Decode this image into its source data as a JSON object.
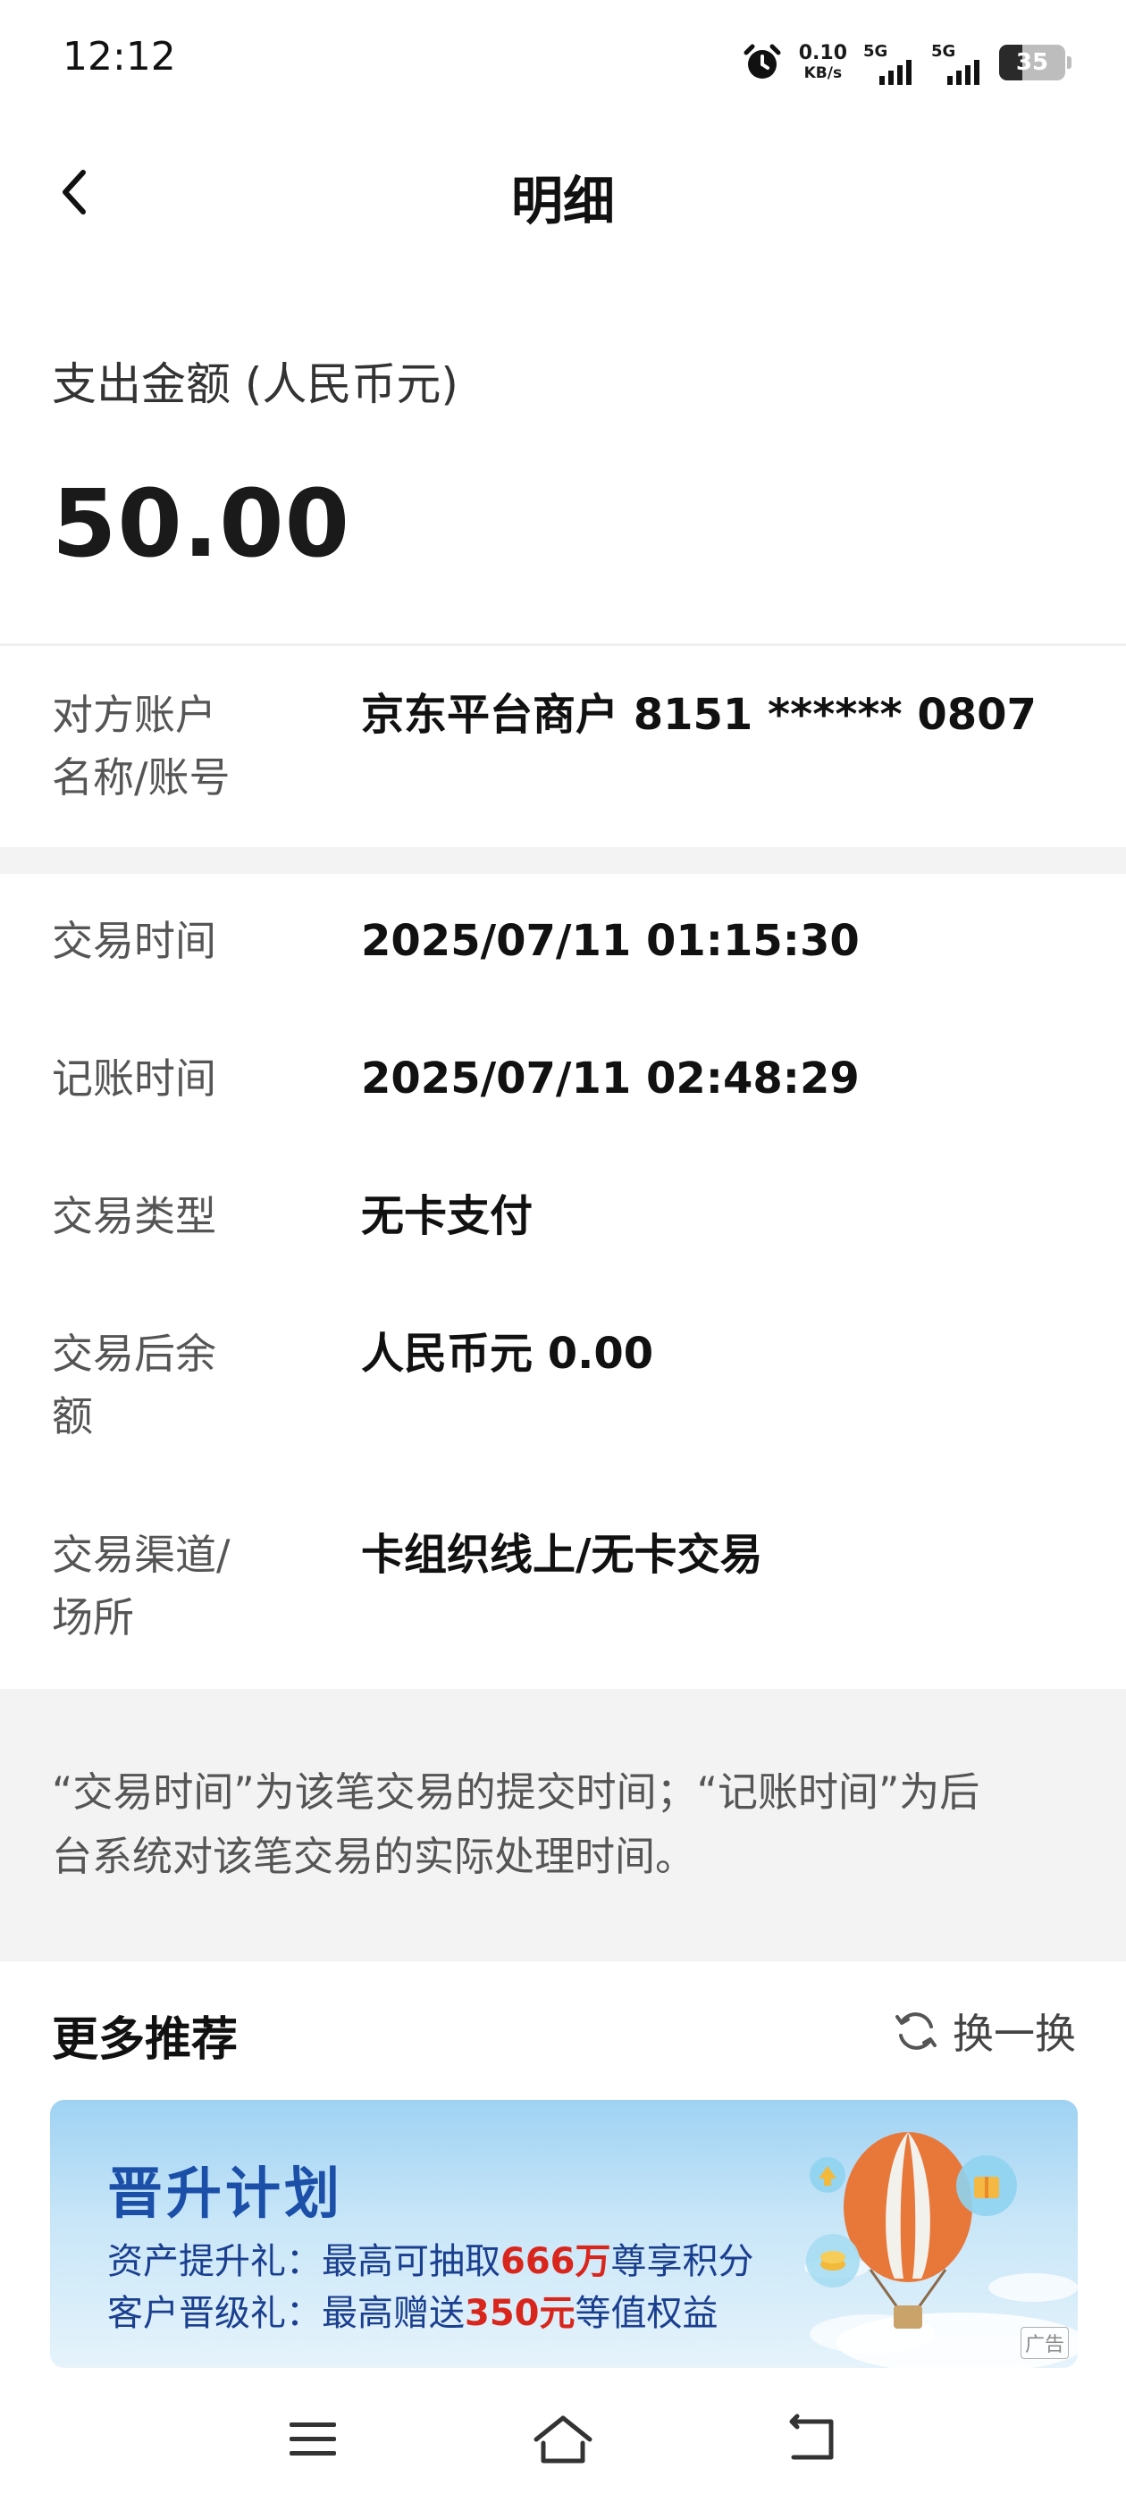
{
  "status_bar": {
    "time": "12:12",
    "net_speed_value": "0.10",
    "net_speed_unit": "KB/s",
    "signal1_label": "5G",
    "signal2_label": "5G",
    "battery_level": "35",
    "battery_fraction": 0.35,
    "icons": [
      "alarm-icon",
      "signal-icon",
      "signal-icon",
      "battery-icon"
    ]
  },
  "header": {
    "title": "明细",
    "back_icon": "chevron-left-icon"
  },
  "amount": {
    "label": "支出金额 (人民币元)",
    "value": "50.00"
  },
  "counterparty": {
    "label_line1": "对方账户",
    "label_line2": "名称/账号",
    "value": "京东平台商户 8151 ****** 0807"
  },
  "details": {
    "txn_time_label": "交易时间",
    "txn_time_value": "2025/07/11 01:15:30",
    "post_time_label": "记账时间",
    "post_time_value": "2025/07/11 02:48:29",
    "txn_type_label": "交易类型",
    "txn_type_value": "无卡支付",
    "balance_label_line1": "交易后余",
    "balance_label_line2": "额",
    "balance_value": "人民币元 0.00",
    "channel_label_line1": "交易渠道/",
    "channel_label_line2": "场所",
    "channel_value": "卡组织线上/无卡交易"
  },
  "note": {
    "line1": "“交易时间”为该笔交易的提交时间；“记账时间”为后",
    "line2": "台系统对该笔交易的实际处理时间。"
  },
  "recommend": {
    "title": "更多推荐",
    "refresh_label": "换一换",
    "refresh_icon": "refresh-icon",
    "banner": {
      "title": "晋升计划",
      "line1_prefix": "资产提升礼：最高可抽取",
      "line1_highlight": "666万",
      "line1_suffix": "尊享积分",
      "line2_prefix": "客户晋级礼：最高赠送",
      "line2_highlight": "350元",
      "line2_suffix": "等值权益",
      "ad_tag": "广告"
    }
  },
  "navbar": {
    "icons": [
      "menu-icon",
      "home-icon",
      "back-icon"
    ]
  },
  "colors": {
    "accent_blue": "#1b4fa8",
    "highlight_red": "#d9261c",
    "section_gray": "#f3f3f3"
  }
}
